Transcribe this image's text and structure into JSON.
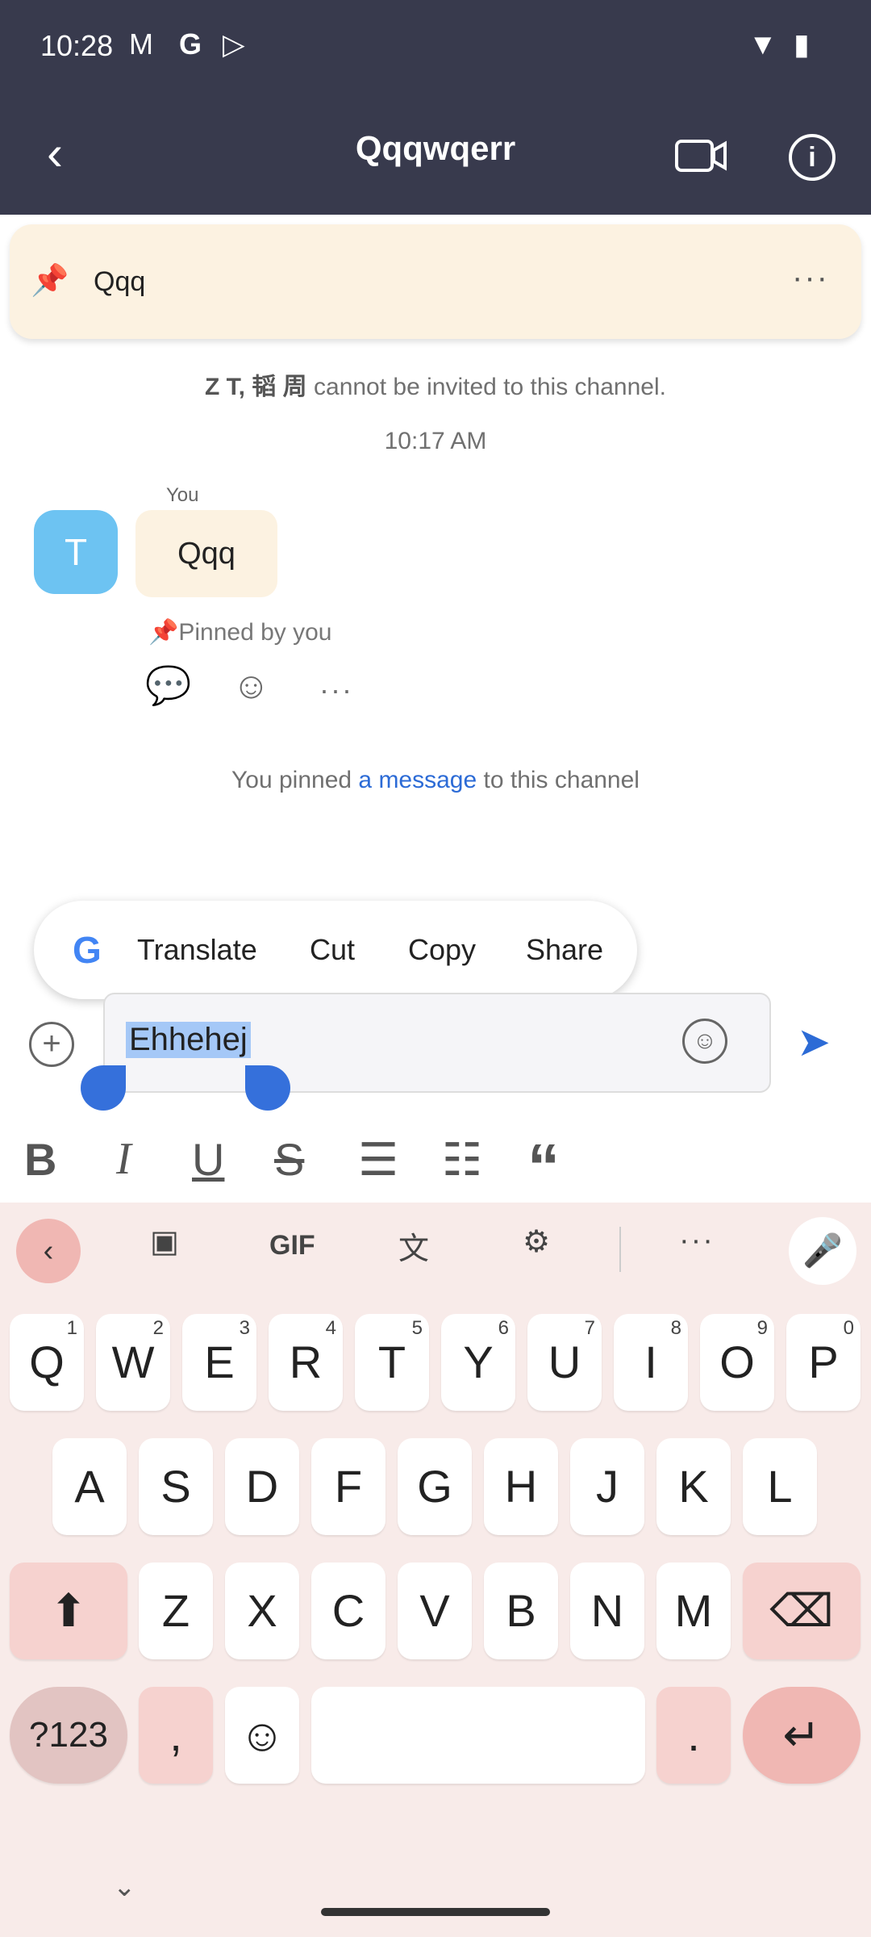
{
  "status_bar": {
    "time": "10:28"
  },
  "header": {
    "title": "Qqqwqerr"
  },
  "pinned_banner": {
    "text": "Qqq",
    "more": "···"
  },
  "system": {
    "not_invited_names": "Z T, 韬 周",
    "not_invited_suffix": " cannot be invited to this channel.",
    "time": "10:17 AM",
    "pinned_prefix": "You pinned ",
    "pinned_link": "a message",
    "pinned_suffix": " to this channel"
  },
  "message": {
    "avatar_letter": "T",
    "sender": "You",
    "text": "Qqq",
    "pinned_by": "Pinned by you"
  },
  "context_menu": {
    "items": [
      "Translate",
      "Cut",
      "Copy",
      "Share"
    ]
  },
  "composer": {
    "value": "Ehhehej"
  },
  "keyboard": {
    "toolbar": {
      "gif": "GIF"
    },
    "row1": [
      {
        "k": "Q",
        "h": "1"
      },
      {
        "k": "W",
        "h": "2"
      },
      {
        "k": "E",
        "h": "3"
      },
      {
        "k": "R",
        "h": "4"
      },
      {
        "k": "T",
        "h": "5"
      },
      {
        "k": "Y",
        "h": "6"
      },
      {
        "k": "U",
        "h": "7"
      },
      {
        "k": "I",
        "h": "8"
      },
      {
        "k": "O",
        "h": "9"
      },
      {
        "k": "P",
        "h": "0"
      }
    ],
    "row2": [
      "A",
      "S",
      "D",
      "F",
      "G",
      "H",
      "J",
      "K",
      "L"
    ],
    "row3": [
      "Z",
      "X",
      "C",
      "V",
      "B",
      "N",
      "M"
    ],
    "symbols": "?123",
    "comma": ",",
    "period": "."
  }
}
